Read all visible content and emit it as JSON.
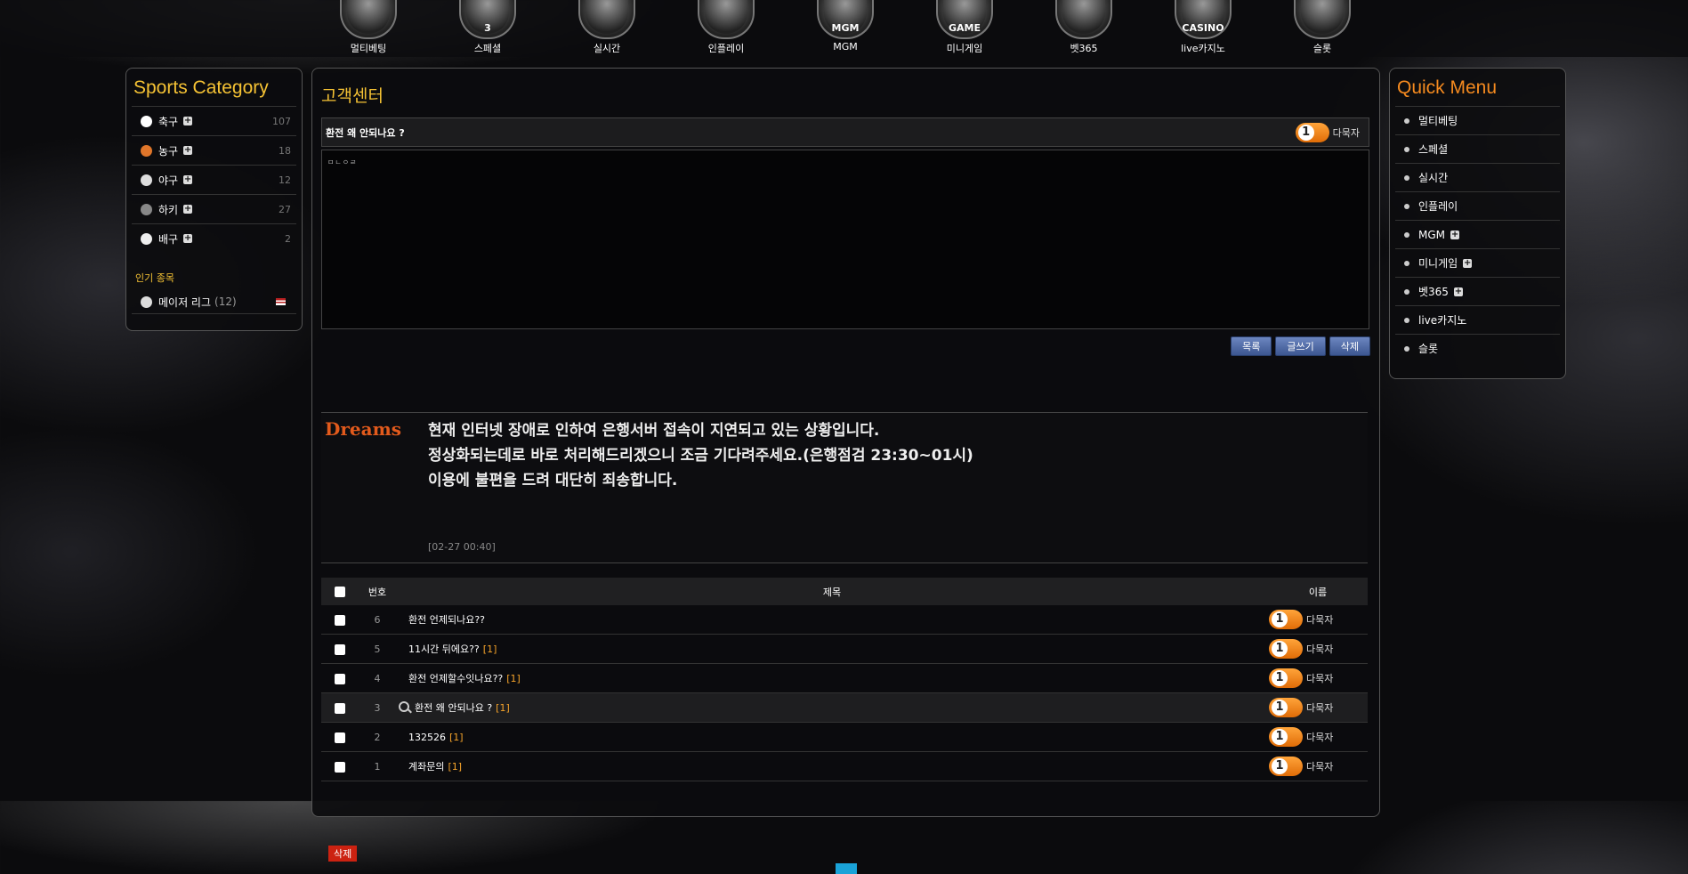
{
  "nav": {
    "items": [
      {
        "label": "멀티베팅",
        "icon": "multi-bet-icon",
        "glyph": "",
        "color": "#3a8a3a"
      },
      {
        "label": "스페셜",
        "icon": "special-3-icon",
        "glyph": "3",
        "color": "#3d4a5a"
      },
      {
        "label": "실시간",
        "icon": "live-soccer-icon",
        "glyph": "",
        "color": "#2a5a8a"
      },
      {
        "label": "인플레이",
        "icon": "inplay-icon",
        "glyph": "",
        "color": "#a33"
      },
      {
        "label": "MGM",
        "icon": "mgm-icon",
        "glyph": "MGM",
        "color": "#3a2a10"
      },
      {
        "label": "미니게임",
        "icon": "minigame-icon",
        "glyph": "GAME",
        "color": "#2b3f5c"
      },
      {
        "label": "벳365",
        "icon": "bet365-icon",
        "glyph": "",
        "color": "#4a4a3a"
      },
      {
        "label": "live카지노",
        "icon": "casino-icon",
        "glyph": "CASINO",
        "color": "#333"
      },
      {
        "label": "슬롯",
        "icon": "slot-icon",
        "glyph": "",
        "color": "#6a2a1a"
      }
    ]
  },
  "sports": {
    "title": "Sports Category",
    "items": [
      {
        "name": "축구",
        "count": "107",
        "ball": "#fff"
      },
      {
        "name": "농구",
        "count": "18",
        "ball": "#e0762a"
      },
      {
        "name": "야구",
        "count": "12",
        "ball": "#ddd"
      },
      {
        "name": "하키",
        "count": "27",
        "ball": "#888"
      },
      {
        "name": "배구",
        "count": "2",
        "ball": "#eee"
      }
    ],
    "popular_title": "인기 종목",
    "popular": {
      "name": "메이저 리그",
      "count": "(12)"
    }
  },
  "quick": {
    "title": "Quick Menu",
    "items": [
      {
        "label": "멀티베팅",
        "plus": false
      },
      {
        "label": "스페셜",
        "plus": false
      },
      {
        "label": "실시간",
        "plus": false
      },
      {
        "label": "인플레이",
        "plus": false
      },
      {
        "label": "MGM",
        "plus": true
      },
      {
        "label": "미니게임",
        "plus": true
      },
      {
        "label": "벳365",
        "plus": true
      },
      {
        "label": "live카지노",
        "plus": false
      },
      {
        "label": "슬롯",
        "plus": false
      }
    ]
  },
  "page": {
    "title": "고객센터"
  },
  "post": {
    "subject": "환전 왜 안되나요 ?",
    "author_level": "1",
    "author": "다묵자",
    "body": "ㅁㄴㅇㄹ"
  },
  "buttons": {
    "list": "목록",
    "write": "글쓰기",
    "delete": "삭제"
  },
  "notice": {
    "logo": "Dreams",
    "lines": [
      "현재 인터넷 장애로 인하여 은행서버 접속이 지연되고 있는 상황입니다.",
      "정상화되는데로 바로 처리해드리겠으니 조금 기다려주세요.(은행점검 23:30~01시)",
      "이용에 불편을 드려 대단히 죄송합니다."
    ],
    "time": "[02-27 00:40]"
  },
  "board": {
    "headers": {
      "num": "번호",
      "title": "제목",
      "name": "이름"
    },
    "rows": [
      {
        "num": "6",
        "title": "환전 언제되나요??",
        "comments": "",
        "author": "다묵자",
        "level": "1",
        "current": false
      },
      {
        "num": "5",
        "title": "11시간 뒤에요??",
        "comments": "[1]",
        "author": "다묵자",
        "level": "1",
        "current": false
      },
      {
        "num": "4",
        "title": "환전 언제할수잇나요??",
        "comments": "[1]",
        "author": "다묵자",
        "level": "1",
        "current": false
      },
      {
        "num": "3",
        "title": "환전 왜 안되나요 ?",
        "comments": "[1]",
        "author": "다묵자",
        "level": "1",
        "current": true
      },
      {
        "num": "2",
        "title": "132526",
        "comments": "[1]",
        "author": "다묵자",
        "level": "1",
        "current": false
      },
      {
        "num": "1",
        "title": "계좌문의",
        "comments": "[1]",
        "author": "다묵자",
        "level": "1",
        "current": false
      }
    ],
    "delete_label": "삭제"
  }
}
